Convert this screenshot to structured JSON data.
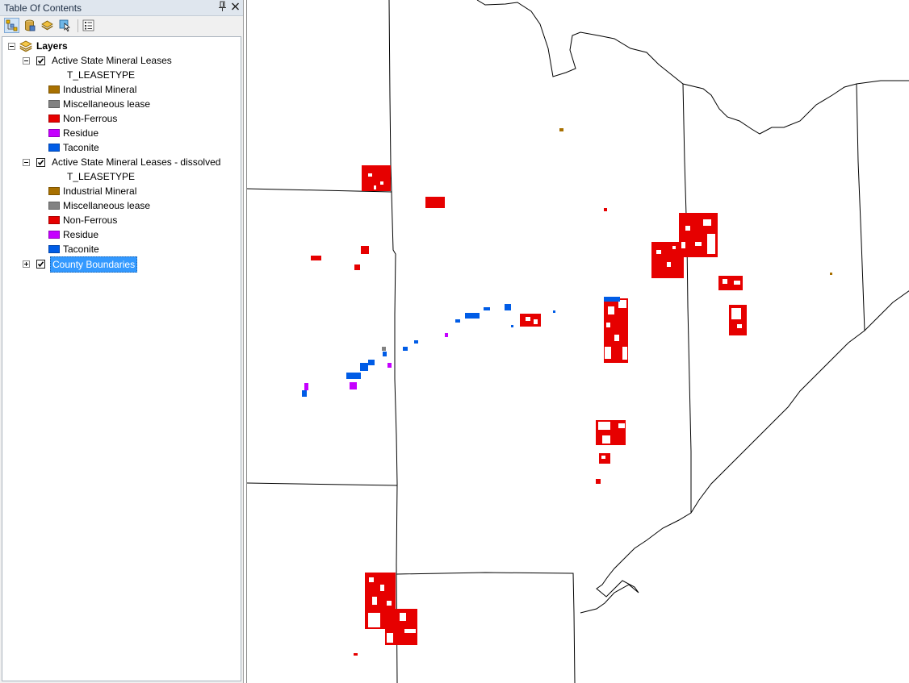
{
  "toc": {
    "title": "Table Of Contents",
    "pin_icon": "pin-icon",
    "close_icon": "close-icon",
    "toolbar": [
      {
        "name": "list-by-drawing-order-icon",
        "active": true
      },
      {
        "name": "list-by-source-icon",
        "active": false
      },
      {
        "name": "list-by-visibility-icon",
        "active": false
      },
      {
        "name": "list-by-selection-icon",
        "active": false
      },
      {
        "name": "options-icon",
        "active": false
      }
    ],
    "root_label": "Layers",
    "layers": [
      {
        "name": "Active State Mineral Leases",
        "checked": true,
        "expanded": true,
        "field": "T_LEASETYPE",
        "classes": [
          {
            "label": "Industrial Mineral",
            "color": "#a87000"
          },
          {
            "label": "Miscellaneous lease",
            "color": "#828282"
          },
          {
            "label": "Non-Ferrous",
            "color": "#e60000"
          },
          {
            "label": "Residue",
            "color": "#c500ff"
          },
          {
            "label": "Taconite",
            "color": "#005ce6"
          }
        ]
      },
      {
        "name": "Active State Mineral Leases - dissolved",
        "checked": true,
        "expanded": true,
        "field": "T_LEASETYPE",
        "classes": [
          {
            "label": "Industrial Mineral",
            "color": "#a87000"
          },
          {
            "label": "Miscellaneous lease",
            "color": "#828282"
          },
          {
            "label": "Non-Ferrous",
            "color": "#e60000"
          },
          {
            "label": "Residue",
            "color": "#c500ff"
          },
          {
            "label": "Taconite",
            "color": "#005ce6"
          }
        ]
      },
      {
        "name": "County Boundaries",
        "checked": true,
        "expanded": false,
        "selected": true
      }
    ]
  },
  "colors": {
    "selection": "#3399ff",
    "boundary": "#000000",
    "non_ferrous": "#e60000",
    "taconite": "#005ce6",
    "residue": "#c500ff",
    "industrial_mineral": "#a87000",
    "miscellaneous": "#828282"
  }
}
